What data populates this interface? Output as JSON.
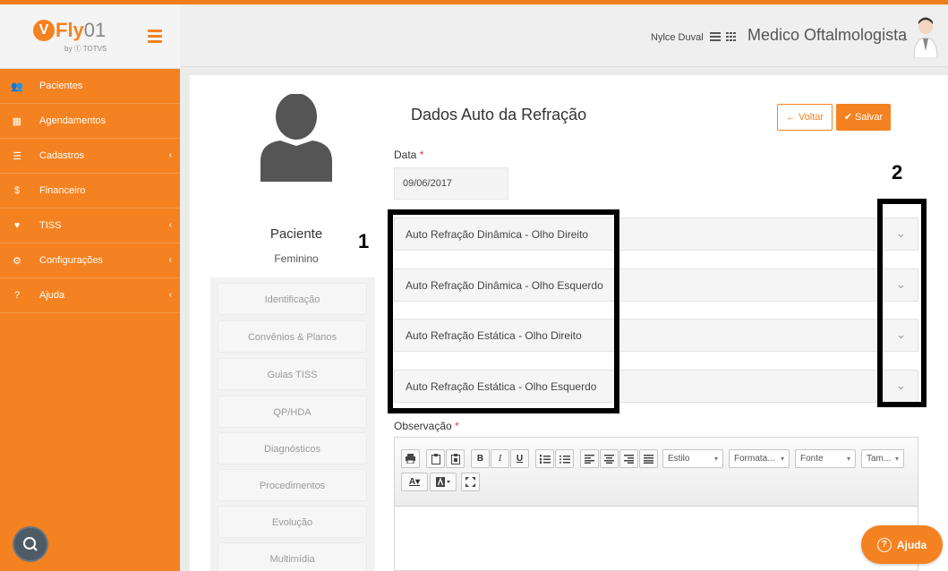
{
  "brand": {
    "logo_mark": "V",
    "name_bold": "Fly",
    "name_light": "01",
    "sub": "by ⓣ TOTVS",
    "accent": "#f58220"
  },
  "sidebar": {
    "items": [
      {
        "label": "Pacientes",
        "icon": "users-icon",
        "glyph": "👥",
        "arrow": ""
      },
      {
        "label": "Agendamentos",
        "icon": "calendar-icon",
        "glyph": "▦",
        "arrow": ""
      },
      {
        "label": "Cadastros",
        "icon": "list-icon",
        "glyph": "☰",
        "arrow": "‹"
      },
      {
        "label": "Financeiro",
        "icon": "dollar-icon",
        "glyph": "$",
        "arrow": ""
      },
      {
        "label": "TISS",
        "icon": "heartbeat-icon",
        "glyph": "♥",
        "arrow": "‹"
      },
      {
        "label": "Configurações",
        "icon": "gear-icon",
        "glyph": "⚙",
        "arrow": "‹"
      },
      {
        "label": "Ajuda",
        "icon": "question-icon",
        "glyph": "?",
        "arrow": "‹"
      }
    ]
  },
  "header": {
    "user_name": "Nylce Duval",
    "role": "Medico Oftalmologista",
    "caret": "⌄"
  },
  "patient": {
    "title": "Paciente",
    "sex": "Feminino",
    "menu": [
      "Identificação",
      "Convênios & Planos",
      "Guias TISS",
      "QP/HDA",
      "Diagnósticos",
      "Procedimentos",
      "Evolução",
      "Multimídia"
    ]
  },
  "form": {
    "title": "Dados Auto da Refração",
    "back_label": "← Voltar",
    "save_label": "✔ Salvar",
    "date_label": "Data",
    "date_value": "09/06/2017",
    "required_mark": "*",
    "sections": [
      "Auto Refração Dinâmica - Olho Direito",
      "Auto Refração Dinâmica - Olho Esquerdo",
      "Auto Refração Estática - Olho Direito",
      "Auto Refração Estática - Olho Esquerdo"
    ],
    "chevron": "⌄",
    "observation_label": "Observação"
  },
  "annotations": {
    "one": "1",
    "two": "2"
  },
  "editor": {
    "style_combo": "Estilo",
    "format_combo": "Formata...",
    "font_combo": "Fonte",
    "size_combo": "Tam...",
    "combo_caret": "▾"
  },
  "help": {
    "label": "Ajuda",
    "glyph": "?"
  }
}
